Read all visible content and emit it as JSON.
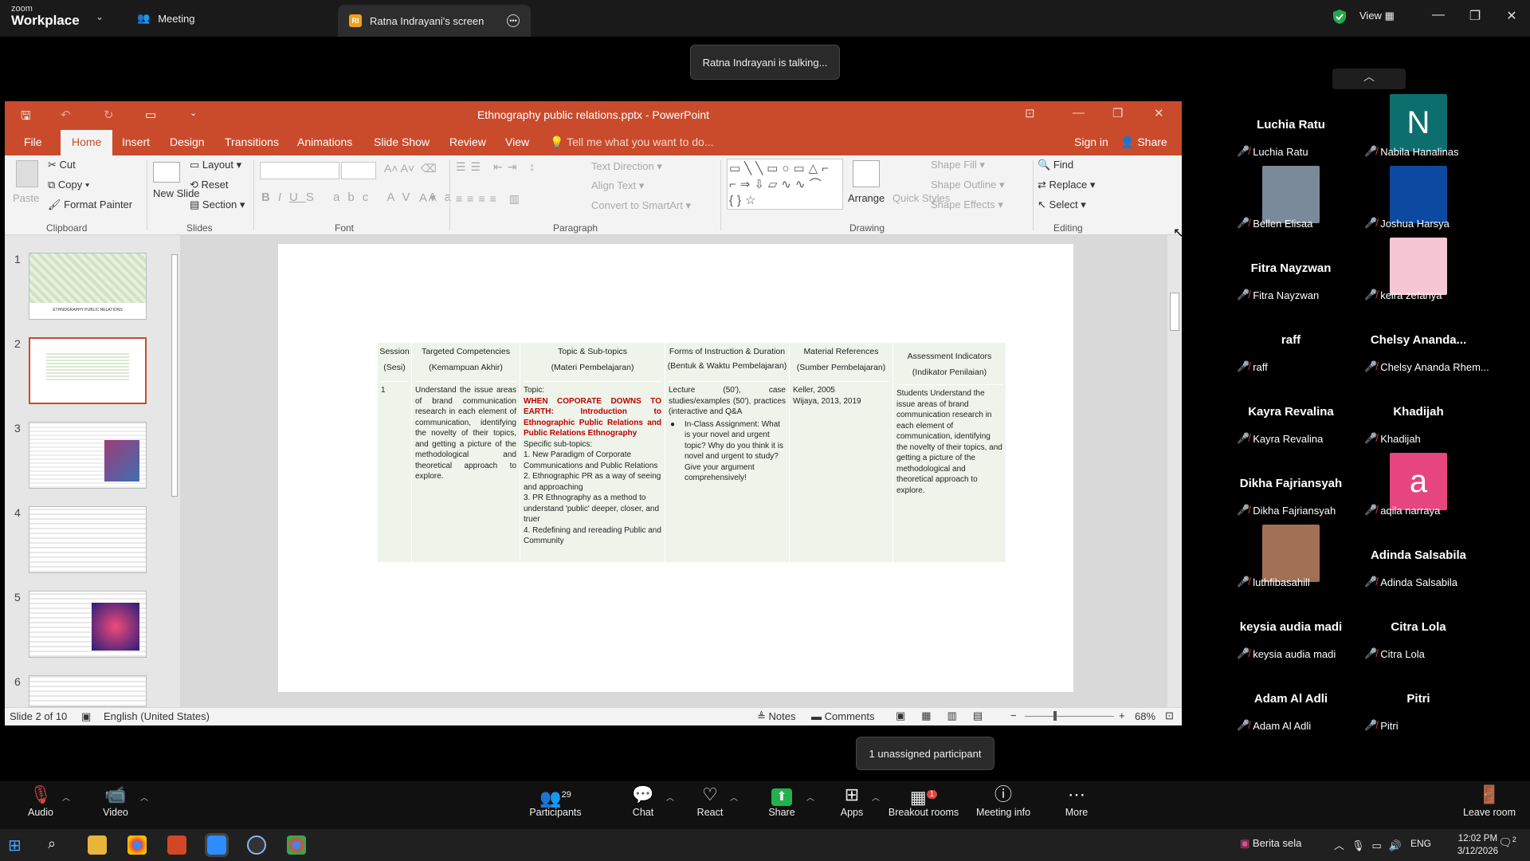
{
  "zoom": {
    "logo_top": "zoom",
    "logo_bottom": "Workplace",
    "tab_meeting": "Meeting",
    "tab_screen": "Ratna Indrayani's screen",
    "tab_screen_avatar": "RI",
    "view_label": "View",
    "talking_toast": "Ratna Indrayani is talking...",
    "unassigned_toast": "1 unassigned participant"
  },
  "ppt": {
    "title": "Ethnography public relations.pptx - PowerPoint",
    "tabs": [
      "File",
      "Home",
      "Insert",
      "Design",
      "Transitions",
      "Animations",
      "Slide Show",
      "Review",
      "View"
    ],
    "tell_me": "Tell me what you want to do...",
    "sign_in": "Sign in",
    "share": "Share",
    "ribbon": {
      "paste": "Paste",
      "cut": "Cut",
      "copy": "Copy",
      "format_painter": "Format Painter",
      "new_slide": "New Slide",
      "layout": "Layout",
      "reset": "Reset",
      "section": "Section",
      "text_direction": "Text Direction",
      "align_text": "Align Text",
      "convert_smartart": "Convert to SmartArt",
      "arrange": "Arrange",
      "quick_styles": "Quick Styles",
      "shape_fill": "Shape Fill",
      "shape_outline": "Shape Outline",
      "shape_effects": "Shape Effects",
      "find": "Find",
      "replace": "Replace",
      "select": "Select",
      "groups": [
        "Clipboard",
        "Slides",
        "Font",
        "Paragraph",
        "Drawing",
        "Editing"
      ]
    },
    "thumb_numbers": [
      "1",
      "2",
      "3",
      "4",
      "5",
      "6"
    ],
    "thumb1_title": "ETHNOGRAPHY PUBLIC RELATIONS",
    "status": {
      "slide": "Slide 2 of 10",
      "language": "English (United States)",
      "notes": "Notes",
      "comments": "Comments",
      "zoom": "68%"
    },
    "table": {
      "headers": [
        [
          "Session",
          "(Sesi)"
        ],
        [
          "Targeted Competencies",
          "(Kemampuan Akhir)"
        ],
        [
          "Topic & Sub-topics",
          "(Materi Pembelajaran)"
        ],
        [
          "Forms of Instruction & Duration",
          "(Bentuk & Waktu Pembelajaran)"
        ],
        [
          "Material References",
          "(Sumber Pembelajaran)"
        ],
        [
          "Assessment Indicators",
          "(Indikator Penilaian)"
        ]
      ],
      "session": "1",
      "competencies": "Understand the issue areas of brand communication research in each element of communication, identifying the novelty of their topics, and getting a picture of the methodological and theoretical approach to explore.",
      "topic_label": "Topic:",
      "topic_red": "WHEN COPORATE DOWNS TO EARTH: Introduction to Ethnographic Public Relations and Public Relations Ethnography",
      "subtopic_label": "Specific sub-topics:",
      "subtopics": [
        "1. New Paradigm of Corporate Communications and Public Relations",
        "2. Ethnographic PR as a way of seeing and approaching",
        "3. PR Ethnography as a method to understand 'public' deeper, closer, and truer",
        "4. Redefining and rereading Public and Community"
      ],
      "forms": "Lecture (50'), case studies/examples (50'), practices (interactive and Q&A",
      "forms_bullet": "In-Class Assignment: What is your novel and urgent topic? Why do you think it is novel and urgent to study? Give your argument comprehensively!",
      "references": [
        "Keller, 2005",
        "Wijaya, 2013, 2019"
      ],
      "assessment": "Students Understand the issue areas of brand communication research in each element of communication, identifying the novelty of their topics, and getting a picture of the methodological and theoretical approach to explore."
    }
  },
  "participants": [
    {
      "name": "Luchia Ratu",
      "label": "Luchia Ratu",
      "kind": "name"
    },
    {
      "name": "N",
      "label": "Nabila Hanalinas",
      "kind": "letter",
      "color": "#0d6e6e"
    },
    {
      "name": "",
      "label": "Bellen Elisaa",
      "kind": "photo",
      "color": "#7a8a9a"
    },
    {
      "name": "",
      "label": "Joshua Harsya",
      "kind": "solid",
      "color": "#0b4aa0"
    },
    {
      "name": "Fitra Nayzwan",
      "label": "Fitra Nayzwan",
      "kind": "name"
    },
    {
      "name": "",
      "label": "keira zefanya",
      "kind": "solid",
      "color": "#f7c6d4"
    },
    {
      "name": "raff",
      "label": "raff",
      "kind": "name"
    },
    {
      "name": "Chelsy  Ananda...",
      "label": "Chelsy Ananda Rhem...",
      "kind": "name"
    },
    {
      "name": "Kayra Revalina",
      "label": "Kayra Revalina",
      "kind": "name"
    },
    {
      "name": "Khadijah",
      "label": "Khadijah",
      "kind": "name"
    },
    {
      "name": "Dikha Fajriansyah",
      "label": "Dikha Fajriansyah",
      "kind": "name"
    },
    {
      "name": "a",
      "label": "aqila narraya",
      "kind": "letter",
      "color": "#e6457e"
    },
    {
      "name": "",
      "label": "luthfibasahill",
      "kind": "photo",
      "color": "#a27055"
    },
    {
      "name": "Adinda Salsabila",
      "label": "Adinda Salsabila",
      "kind": "name"
    },
    {
      "name": "keysia audia madi",
      "label": "keysia audia madi",
      "kind": "name"
    },
    {
      "name": "Citra Lola",
      "label": "Citra Lola",
      "kind": "name"
    },
    {
      "name": "Adam Al Adli",
      "label": "Adam Al Adli",
      "kind": "name"
    },
    {
      "name": "Pitri",
      "label": "Pitri",
      "kind": "name"
    }
  ],
  "toolbar": {
    "audio": "Audio",
    "video": "Video",
    "participants": "Participants",
    "participants_count": "29",
    "chat": "Chat",
    "react": "React",
    "share": "Share",
    "apps": "Apps",
    "breakout": "Breakout rooms",
    "breakout_badge": "1",
    "meeting_info": "Meeting info",
    "more": "More",
    "leave": "Leave room"
  },
  "taskbar": {
    "news": "Berita sela",
    "lang": "ENG",
    "time": "12:02 PM",
    "date": "3/12/2026",
    "notif": "2"
  }
}
